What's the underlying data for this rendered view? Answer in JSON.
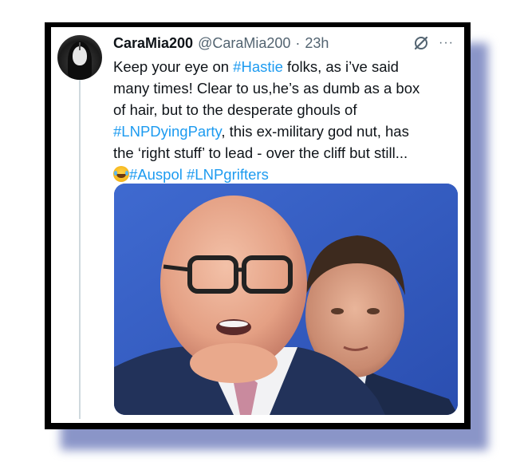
{
  "tweet": {
    "display_name": "CaraMia200",
    "handle": "@CaraMia200",
    "separator": "·",
    "time": "23h",
    "more_label": "···",
    "lines": [
      {
        "segments": [
          {
            "text": "Keep your eye on ",
            "tag": false
          },
          {
            "text": "#Hastie",
            "tag": true
          },
          {
            "text": " folks, as i’ve said",
            "tag": false
          }
        ]
      },
      {
        "segments": [
          {
            "text": "many times! Clear to us,he’s as dumb as a box",
            "tag": false
          }
        ]
      },
      {
        "segments": [
          {
            "text": "of hair, but to the desperate ghouls of",
            "tag": false
          }
        ]
      },
      {
        "segments": [
          {
            "text": "#LNPDyingParty",
            "tag": true
          },
          {
            "text": ", this ex-military god nut, has",
            "tag": false
          }
        ]
      },
      {
        "segments": [
          {
            "text": "the ‘right stuff’ to lead - over the cliff but still...",
            "tag": false
          }
        ]
      },
      {
        "emoji": "face-with-tears-of-joy",
        "segments": [
          {
            "text": "#Auspol",
            "tag": true
          },
          {
            "text": " ",
            "tag": false
          },
          {
            "text": "#LNPgrifters",
            "tag": true
          }
        ]
      }
    ]
  },
  "icons": {
    "avatar": "profile-photo",
    "grok": "grok-slash-icon",
    "more": "more-options-icon"
  },
  "colors": {
    "link": "#1d9bf0",
    "text": "#0f1419",
    "muted": "#536471",
    "frame": "#000000",
    "shadow": "#8a95c8",
    "media_background": "#2f55be"
  }
}
